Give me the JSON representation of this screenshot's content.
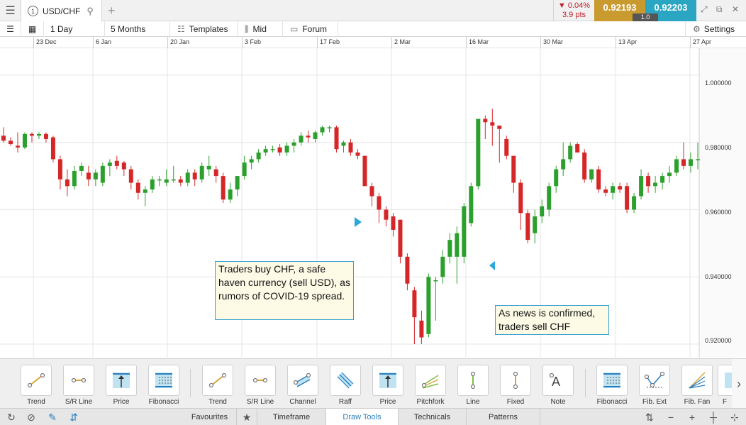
{
  "instrument": "USD/CHF",
  "tab_number": "1",
  "change": {
    "percent": "0.04%",
    "points": "3.9 pts"
  },
  "sell_price": "0.92193",
  "buy_price": "0.92203",
  "spread": "1.0",
  "colors": {
    "sell": "#c99a2e",
    "buy": "#2aa5c2",
    "up": "#2ca02c",
    "down": "#d62728",
    "callout_border": "#3aa0d4",
    "callout_bg": "#fdfbe6"
  },
  "toolbar": {
    "timeframe": "1 Day",
    "range": "5 Months",
    "templates": "Templates",
    "price_type": "Mid",
    "forum": "Forum",
    "settings": "Settings"
  },
  "date_axis": [
    "23 Dec",
    "6 Jan",
    "20 Jan",
    "3 Feb",
    "17 Feb",
    "2 Mar",
    "16 Mar",
    "30 Mar",
    "13 Apr",
    "27 Apr"
  ],
  "price_axis": [
    "1.000000",
    "0.980000",
    "0.960000",
    "0.940000",
    "0.920000"
  ],
  "callouts": [
    "Traders buy CHF, a safe haven currency (sell USD), as rumors of COVID-19 spread.",
    "As news is confirmed, traders sell CHF"
  ],
  "draw_tools": [
    {
      "label": "Trend",
      "icon": "trend-line-icon"
    },
    {
      "label": "S/R Line",
      "icon": "sr-line-icon"
    },
    {
      "label": "Price",
      "icon": "price-line-icon"
    },
    {
      "label": "Fibonacci",
      "icon": "fibonacci-icon"
    },
    {
      "label": "Trend",
      "icon": "trend-line-icon"
    },
    {
      "label": "S/R Line",
      "icon": "sr-line-icon"
    },
    {
      "label": "Channel",
      "icon": "channel-icon"
    },
    {
      "label": "Raff",
      "icon": "raff-icon"
    },
    {
      "label": "Price",
      "icon": "price-line-icon"
    },
    {
      "label": "Pitchfork",
      "icon": "pitchfork-icon"
    },
    {
      "label": "Line",
      "icon": "vertical-line-icon"
    },
    {
      "label": "Fixed",
      "icon": "fixed-line-icon"
    },
    {
      "label": "Note",
      "icon": "note-icon"
    },
    {
      "label": "Fibonacci",
      "icon": "fibonacci-icon"
    },
    {
      "label": "Fib. Ext",
      "icon": "fib-ext-icon"
    },
    {
      "label": "Fib. Fan",
      "icon": "fib-fan-icon"
    },
    {
      "label": "F",
      "icon": "fib-icon"
    }
  ],
  "bottom_tabs": [
    "Favourites",
    "Timeframe",
    "Draw Tools",
    "Technicals",
    "Patterns"
  ],
  "active_tab": "Draw Tools",
  "chart_data": {
    "type": "candlestick",
    "instrument": "USD/CHF",
    "ylim": [
      0.916,
      1.008
    ],
    "candles": [
      [
        0.982,
        0.9845,
        0.98,
        0.9805
      ],
      [
        0.9805,
        0.9815,
        0.979,
        0.9795
      ],
      [
        0.979,
        0.983,
        0.977,
        0.9785
      ],
      [
        0.9785,
        0.983,
        0.978,
        0.9825
      ],
      [
        0.9825,
        0.983,
        0.98,
        0.982
      ],
      [
        0.982,
        0.983,
        0.981,
        0.9825
      ],
      [
        0.9825,
        0.983,
        0.98,
        0.981
      ],
      [
        0.9815,
        0.982,
        0.974,
        0.975
      ],
      [
        0.975,
        0.976,
        0.966,
        0.969
      ],
      [
        0.969,
        0.972,
        0.964,
        0.967
      ],
      [
        0.967,
        0.973,
        0.966,
        0.9715
      ],
      [
        0.9715,
        0.974,
        0.97,
        0.973
      ],
      [
        0.971,
        0.973,
        0.967,
        0.969
      ],
      [
        0.969,
        0.972,
        0.967,
        0.971
      ],
      [
        0.968,
        0.974,
        0.967,
        0.973
      ],
      [
        0.973,
        0.975,
        0.97,
        0.974
      ],
      [
        0.9745,
        0.976,
        0.972,
        0.973
      ],
      [
        0.974,
        0.9745,
        0.97,
        0.972
      ],
      [
        0.972,
        0.973,
        0.966,
        0.968
      ],
      [
        0.968,
        0.969,
        0.963,
        0.965
      ],
      [
        0.965,
        0.967,
        0.961,
        0.966
      ],
      [
        0.966,
        0.97,
        0.965,
        0.969
      ],
      [
        0.969,
        0.97,
        0.967,
        0.969
      ],
      [
        0.968,
        0.972,
        0.967,
        0.969
      ],
      [
        0.969,
        0.973,
        0.968,
        0.969
      ],
      [
        0.969,
        0.97,
        0.967,
        0.968
      ],
      [
        0.968,
        0.972,
        0.967,
        0.971
      ],
      [
        0.971,
        0.972,
        0.967,
        0.969
      ],
      [
        0.969,
        0.974,
        0.968,
        0.973
      ],
      [
        0.972,
        0.976,
        0.97,
        0.973
      ],
      [
        0.972,
        0.973,
        0.968,
        0.97
      ],
      [
        0.97,
        0.971,
        0.962,
        0.963
      ],
      [
        0.963,
        0.968,
        0.962,
        0.966
      ],
      [
        0.966,
        0.97,
        0.964,
        0.97
      ],
      [
        0.97,
        0.976,
        0.969,
        0.974
      ],
      [
        0.974,
        0.976,
        0.972,
        0.975
      ],
      [
        0.975,
        0.978,
        0.974,
        0.977
      ],
      [
        0.977,
        0.979,
        0.976,
        0.978
      ],
      [
        0.978,
        0.979,
        0.977,
        0.978
      ],
      [
        0.9785,
        0.9795,
        0.976,
        0.977
      ],
      [
        0.977,
        0.98,
        0.976,
        0.979
      ],
      [
        0.979,
        0.981,
        0.977,
        0.98
      ],
      [
        0.98,
        0.983,
        0.979,
        0.982
      ],
      [
        0.982,
        0.9835,
        0.98,
        0.9815
      ],
      [
        0.981,
        0.9835,
        0.98,
        0.983
      ],
      [
        0.983,
        0.985,
        0.982,
        0.9845
      ],
      [
        0.9845,
        0.985,
        0.983,
        0.9845
      ],
      [
        0.9845,
        0.985,
        0.977,
        0.978
      ],
      [
        0.979,
        0.9805,
        0.977,
        0.98
      ],
      [
        0.98,
        0.981,
        0.976,
        0.977
      ],
      [
        0.977,
        0.978,
        0.975,
        0.976
      ],
      [
        0.976,
        0.976,
        0.967,
        0.967
      ],
      [
        0.967,
        0.968,
        0.961,
        0.964
      ],
      [
        0.964,
        0.965,
        0.956,
        0.96
      ],
      [
        0.96,
        0.961,
        0.955,
        0.957
      ],
      [
        0.958,
        0.959,
        0.952,
        0.954
      ],
      [
        0.957,
        0.957,
        0.944,
        0.946
      ],
      [
        0.946,
        0.947,
        0.936,
        0.938
      ],
      [
        0.936,
        0.937,
        0.92,
        0.928
      ],
      [
        0.927,
        0.93,
        0.92,
        0.922
      ],
      [
        0.923,
        0.941,
        0.922,
        0.94
      ],
      [
        0.939,
        0.94,
        0.927,
        0.939
      ],
      [
        0.94,
        0.948,
        0.938,
        0.946
      ],
      [
        0.946,
        0.953,
        0.944,
        0.951
      ],
      [
        0.946,
        0.955,
        0.938,
        0.953
      ],
      [
        0.946,
        0.962,
        0.944,
        0.961
      ],
      [
        0.956,
        0.968,
        0.955,
        0.967
      ],
      [
        0.967,
        0.981,
        0.966,
        0.987
      ],
      [
        0.987,
        0.988,
        0.981,
        0.986
      ],
      [
        0.986,
        0.99,
        0.979,
        0.985
      ],
      [
        0.985,
        0.985,
        0.974,
        0.984
      ],
      [
        0.981,
        0.982,
        0.975,
        0.976
      ],
      [
        0.976,
        0.976,
        0.965,
        0.968
      ],
      [
        0.968,
        0.969,
        0.954,
        0.959
      ],
      [
        0.959,
        0.96,
        0.95,
        0.951
      ],
      [
        0.953,
        0.96,
        0.95,
        0.958
      ],
      [
        0.958,
        0.963,
        0.956,
        0.961
      ],
      [
        0.96,
        0.968,
        0.958,
        0.967
      ],
      [
        0.967,
        0.973,
        0.965,
        0.972
      ],
      [
        0.972,
        0.98,
        0.97,
        0.975
      ],
      [
        0.975,
        0.98,
        0.974,
        0.979
      ],
      [
        0.9795,
        0.98,
        0.977,
        0.977
      ],
      [
        0.977,
        0.978,
        0.968,
        0.969
      ],
      [
        0.969,
        0.971,
        0.968,
        0.972
      ],
      [
        0.972,
        0.973,
        0.965,
        0.966
      ],
      [
        0.966,
        0.967,
        0.964,
        0.965
      ],
      [
        0.965,
        0.968,
        0.963,
        0.967
      ],
      [
        0.967,
        0.968,
        0.965,
        0.966
      ],
      [
        0.967,
        0.968,
        0.959,
        0.96
      ],
      [
        0.96,
        0.965,
        0.959,
        0.964
      ],
      [
        0.964,
        0.972,
        0.963,
        0.97
      ],
      [
        0.97,
        0.971,
        0.965,
        0.967
      ],
      [
        0.967,
        0.97,
        0.965,
        0.968
      ],
      [
        0.968,
        0.971,
        0.966,
        0.97
      ],
      [
        0.97,
        0.973,
        0.968,
        0.971
      ],
      [
        0.971,
        0.976,
        0.97,
        0.975
      ],
      [
        0.975,
        0.98,
        0.972,
        0.973
      ],
      [
        0.973,
        0.977,
        0.971,
        0.975
      ],
      [
        0.975,
        0.98,
        0.972,
        0.975
      ]
    ]
  }
}
